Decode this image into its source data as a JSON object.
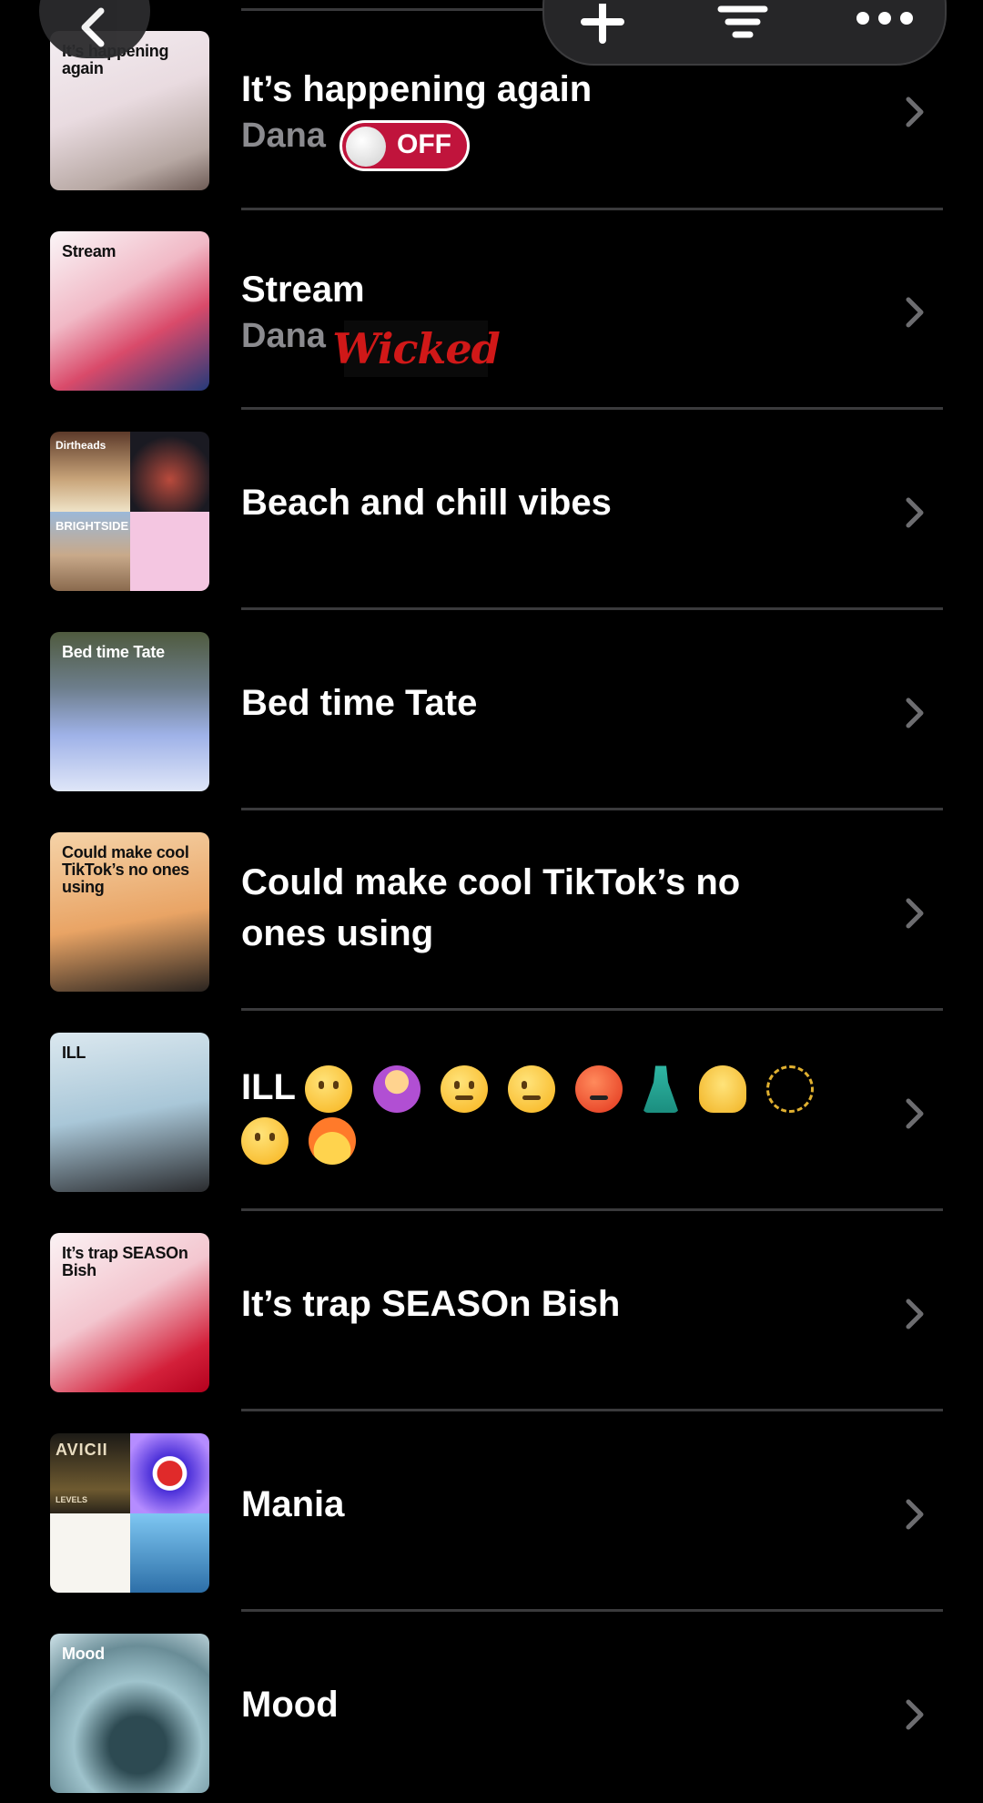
{
  "playlists": [
    {
      "title": "It’s happening again",
      "subtitle": "Dana",
      "thumb_label": "It’s happening again"
    },
    {
      "title": "Stream",
      "subtitle": "Dana",
      "thumb_label": "Stream"
    },
    {
      "title": "Beach and chill vibes",
      "thumb_tiles": [
        "Dirtheads",
        "",
        "BRIGHTSIDE",
        ""
      ]
    },
    {
      "title": "Bed time Tate",
      "thumb_label": "Bed time Tate"
    },
    {
      "title": "Could make cool TikTok’s no ones using",
      "thumb_label": "Could make cool TikTok’s no ones using"
    },
    {
      "title": "ILL",
      "thumb_label": "ILL"
    },
    {
      "title": "It’s trap SEASOn Bish",
      "thumb_label": "It’s trap SEASOn Bish"
    },
    {
      "title": "Mania",
      "thumb_tiles": [
        "AVICII",
        "",
        "",
        ""
      ],
      "thumb_tile_sub": "LEVELS"
    },
    {
      "title": "Mood",
      "thumb_label": "Mood"
    }
  ],
  "overlay": {
    "toggle_label": "OFF",
    "sticker_text": "Wicked"
  },
  "icons": {
    "back": "chevron-left-icon",
    "add": "plus-icon",
    "sort": "sort-lines-icon",
    "more": "more-dots-icon",
    "row_chevron": "chevron-right-icon"
  },
  "colors": {
    "background": "#000000",
    "subtitle": "#8b8b8f",
    "separator": "#3a3a3c",
    "toggle_off": "#c0143c",
    "sticker_red": "#d01818"
  }
}
